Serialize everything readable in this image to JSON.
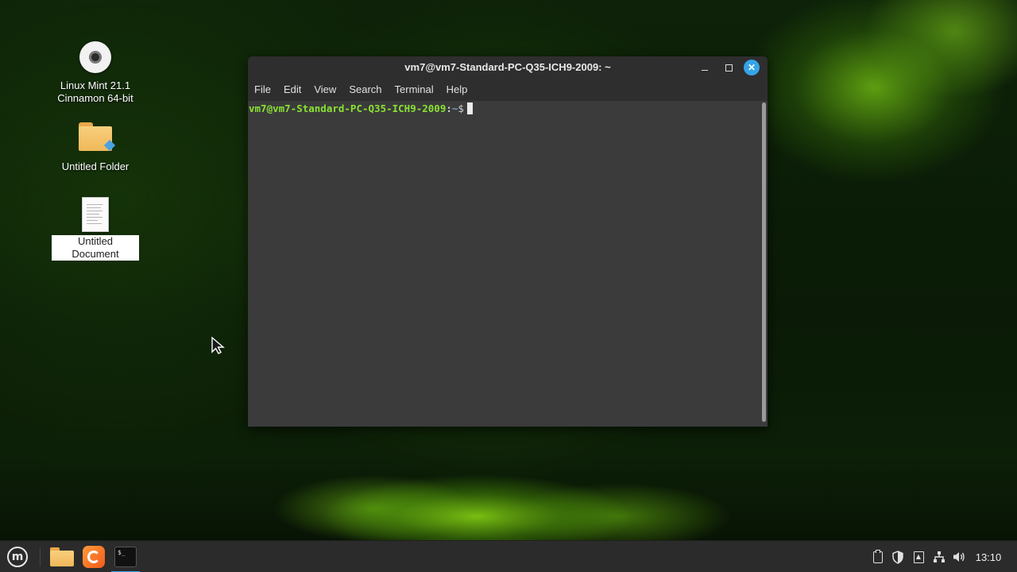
{
  "desktop": {
    "icons": [
      {
        "label_line1": "Linux Mint 21.1",
        "label_line2": "Cinnamon 64-bit",
        "icon": "disc-icon"
      },
      {
        "label": "Untitled Folder",
        "icon": "folder-icon"
      },
      {
        "label_line1": "Untitled",
        "label_line2": "Document",
        "icon": "document-icon",
        "selected": true
      }
    ]
  },
  "terminal": {
    "title": "vm7@vm7-Standard-PC-Q35-ICH9-2009: ~",
    "menu": [
      "File",
      "Edit",
      "View",
      "Search",
      "Terminal",
      "Help"
    ],
    "prompt_user_host": "vm7@vm7-Standard-PC-Q35-ICH9-2009",
    "prompt_sep": ":",
    "prompt_path": "~",
    "prompt_symbol": "$",
    "colors": {
      "prompt_user": "#8ae234",
      "prompt_path": "#729fcf",
      "background": "#3b3b3b",
      "close_button": "#35a4e8"
    }
  },
  "taskbar": {
    "menu_icon": "linux-mint-logo-icon",
    "launchers": [
      "files-icon",
      "firefox-icon",
      "terminal-icon"
    ],
    "terminal_glyph": "$_",
    "tray_icons": [
      "clipboard-icon",
      "shield-icon",
      "update-manager-icon",
      "network-icon",
      "volume-icon"
    ],
    "clock": "13:10"
  }
}
